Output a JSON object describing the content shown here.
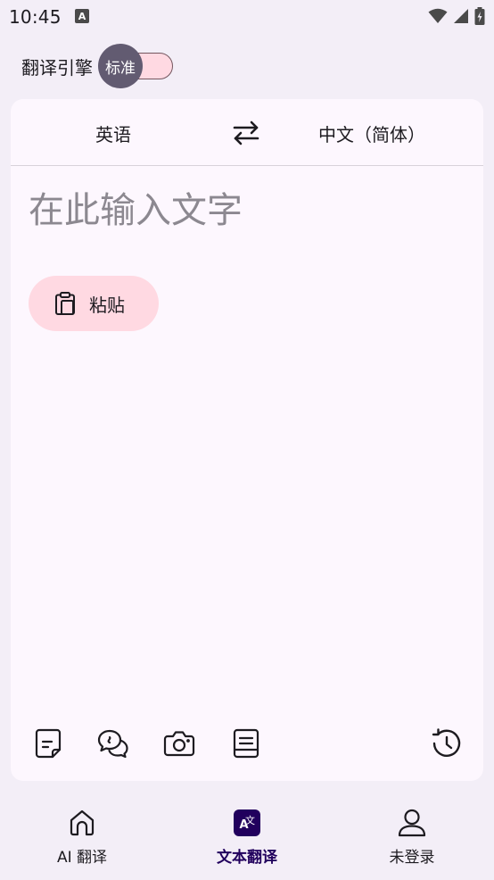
{
  "status_bar": {
    "time": "10:45",
    "notification_icon": "a-icon",
    "icons": [
      "wifi-icon",
      "signal-icon",
      "battery-icon"
    ]
  },
  "engine": {
    "label": "翻译引擎",
    "switch_value": "标准"
  },
  "languages": {
    "source": "英语",
    "target": "中文（简体）",
    "swap_icon": "swap-arrows-icon"
  },
  "input": {
    "placeholder": "在此输入文字",
    "value": ""
  },
  "paste": {
    "label": "粘贴",
    "icon": "clipboard-icon"
  },
  "tools": {
    "icons": [
      "note-icon",
      "conversation-icon",
      "camera-icon",
      "document-icon",
      "history-icon"
    ]
  },
  "nav": {
    "items": [
      {
        "label": "AI 翻译",
        "icon": "home-icon",
        "active": false
      },
      {
        "label": "文本翻译",
        "icon": "translate-icon",
        "active": true
      },
      {
        "label": "未登录",
        "icon": "person-icon",
        "active": false
      }
    ]
  },
  "colors": {
    "background": "#f3eef7",
    "card": "#fdf7fe",
    "accent_pink": "#ffd9e2",
    "thumb": "#625b71",
    "active_nav": "#21005d"
  }
}
